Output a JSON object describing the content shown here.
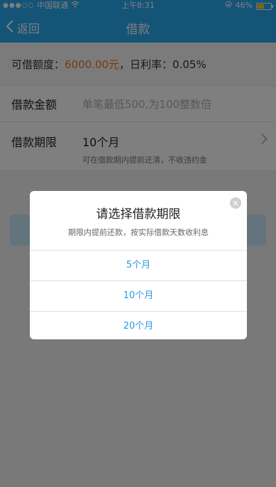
{
  "status_bar": {
    "carrier": "中国联通",
    "signal_dots": "●●●○○",
    "time": "上午8:31",
    "battery": "46%",
    "battery_level": 0.46
  },
  "nav": {
    "back_label": "返回",
    "title": "借款"
  },
  "quota": {
    "label": "可借额度：",
    "amount": "6000.00元",
    "rate_text": "，日利率：0.05%"
  },
  "form": {
    "amount_label": "借款金额",
    "amount_placeholder": "单笔最低500,为100整数倍",
    "term_label": "借款期限",
    "term_value": "10个月",
    "term_hint": "可在借款期内提前还清，不收违约金"
  },
  "dialog": {
    "title": "请选择借款期限",
    "subtitle": "期限内提前还款，按实际借款天数收利息",
    "close_glyph": "×",
    "options": [
      "5个月",
      "10个月",
      "20个月"
    ]
  },
  "colors": {
    "brand": "#29a8ee",
    "accent": "#e9782b",
    "option_text": "#2a9be0"
  }
}
